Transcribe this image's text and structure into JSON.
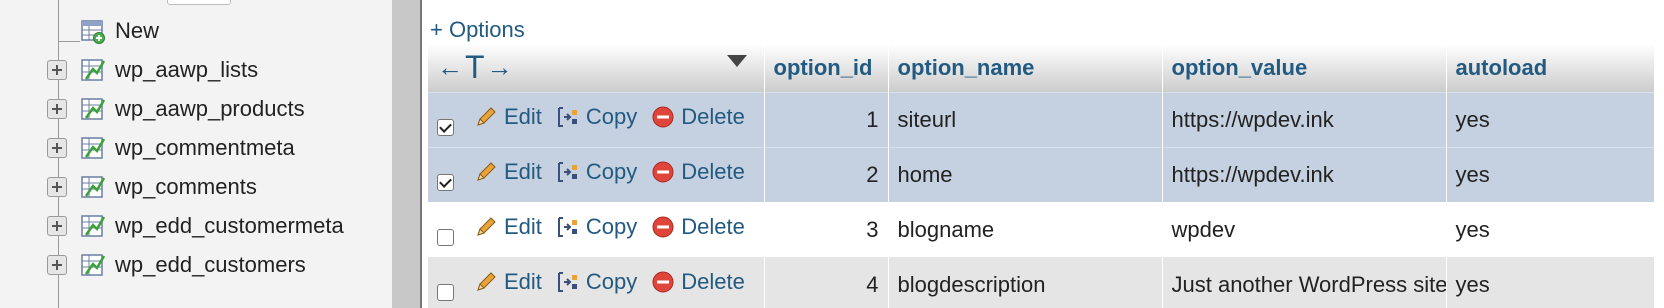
{
  "sidebar": {
    "new_label": "New",
    "tables": [
      {
        "label": "wp_aawp_lists"
      },
      {
        "label": "wp_aawp_products"
      },
      {
        "label": "wp_commentmeta"
      },
      {
        "label": "wp_comments"
      },
      {
        "label": "wp_edd_customermeta"
      },
      {
        "label": "wp_edd_customers"
      }
    ]
  },
  "main": {
    "options_link": "+ Options",
    "columns": [
      "option_id",
      "option_name",
      "option_value",
      "autoload"
    ],
    "actions": {
      "edit": "Edit",
      "copy": "Copy",
      "delete": "Delete"
    },
    "rows": [
      {
        "checked": true,
        "option_id": "1",
        "option_name": "siteurl",
        "option_value": "https://wpdev.ink",
        "autoload": "yes"
      },
      {
        "checked": true,
        "option_id": "2",
        "option_name": "home",
        "option_value": "https://wpdev.ink",
        "autoload": "yes"
      },
      {
        "checked": false,
        "option_id": "3",
        "option_name": "blogname",
        "option_value": "wpdev",
        "autoload": "yes"
      },
      {
        "checked": false,
        "option_id": "4",
        "option_name": "blogdescription",
        "option_value": "Just another WordPress site",
        "autoload": "yes"
      }
    ]
  },
  "colors": {
    "link": "#235a81",
    "marked_row": "#c5d1e0",
    "even_row": "#e5e5e5",
    "delete_icon": "#e0453b",
    "edit_icon": "#e8a43a"
  }
}
